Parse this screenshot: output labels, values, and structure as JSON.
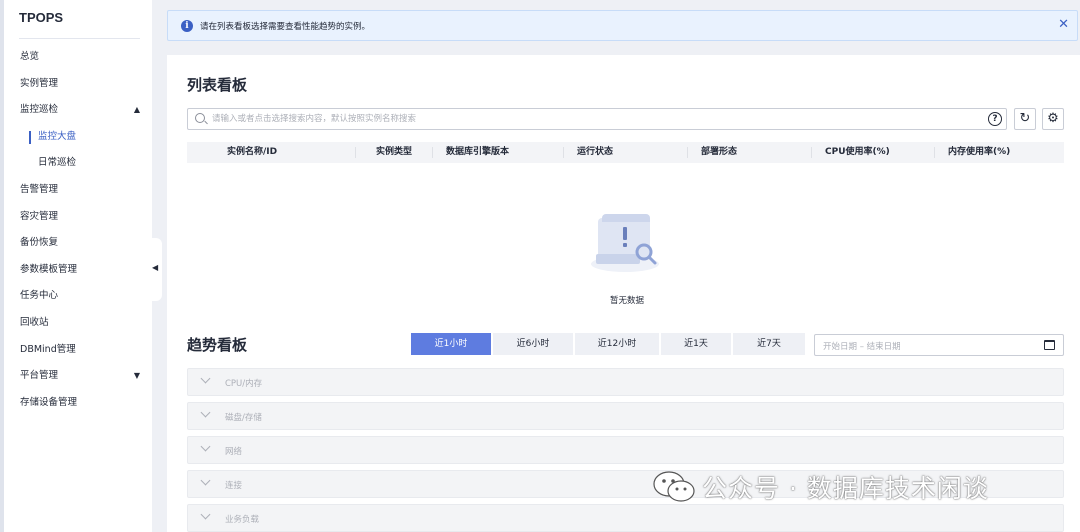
{
  "app": {
    "title": "TPOPS"
  },
  "sidebar": {
    "items": [
      {
        "label": "总览"
      },
      {
        "label": "实例管理"
      },
      {
        "label": "监控巡检",
        "expanded": true
      },
      {
        "label": "监控大盘",
        "sub": true,
        "active": true
      },
      {
        "label": "日常巡检",
        "sub": true
      },
      {
        "label": "告警管理"
      },
      {
        "label": "容灾管理"
      },
      {
        "label": "备份恢复"
      },
      {
        "label": "参数模板管理"
      },
      {
        "label": "任务中心"
      },
      {
        "label": "回收站"
      },
      {
        "label": "DBMind管理"
      },
      {
        "label": "平台管理",
        "collapsed": true
      },
      {
        "label": "存储设备管理"
      }
    ]
  },
  "banner": {
    "message": "请在列表看板选择需要查看性能趋势的实例。"
  },
  "list_board": {
    "title": "列表看板",
    "search_placeholder": "请输入或者点击选择搜索内容，默认按照实例名称搜索",
    "columns": [
      "实例名称/ID",
      "实例类型",
      "数据库引擎版本",
      "运行状态",
      "部署形态",
      "CPU使用率(%)",
      "内存使用率(%)"
    ],
    "empty_text": "暂无数据"
  },
  "trend_board": {
    "title": "趋势看板",
    "ranges": [
      "近1小时",
      "近6小时",
      "近12小时",
      "近1天",
      "近7天"
    ],
    "active_range": 0,
    "date_placeholder": "开始日期 – 结束日期",
    "panels": [
      "CPU/内存",
      "磁盘/存储",
      "网络",
      "连接",
      "业务负载"
    ]
  },
  "watermark": {
    "text": "公众号 · 数据库技术闲谈"
  },
  "colors": {
    "accent": "#5e7ce0",
    "active_text": "#3b60c4",
    "banner_bg": "#e9f2fe"
  }
}
